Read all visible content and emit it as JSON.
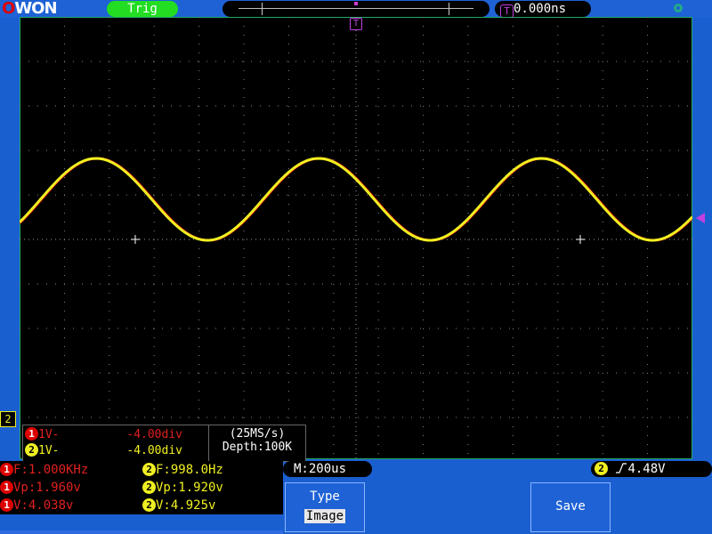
{
  "top": {
    "logo": "OWON",
    "trig_status": "Trig",
    "trig_delay": "0.000ns",
    "trig_icon": "T"
  },
  "channels": {
    "ch1": {
      "label": "1V-",
      "offset": "-4.00div"
    },
    "ch2": {
      "label": "1V-",
      "offset": "-4.00div"
    }
  },
  "acq": {
    "sample_rate": "(25MS/s)",
    "depth": "Depth:100K"
  },
  "measurements": {
    "ch1": {
      "freq": "F:1.000KHz",
      "vp": "Vp:1.960v",
      "v": "V:4.038v"
    },
    "ch2": {
      "freq": "F:998.0Hz",
      "vp": "Vp:1.920v",
      "v": "V:4.925v"
    }
  },
  "timebase": "M:200us",
  "trigger_level": "4.48V",
  "buttons": {
    "type_label": "Type",
    "type_value": "Image",
    "save_label": "Save"
  },
  "ch2_marker": "2",
  "colors": {
    "ch1": "#e01010",
    "ch2": "#f0f020",
    "trigger": "#c040e0",
    "frame": "#1a5fd0"
  },
  "icons": {
    "usb": "usb-icon",
    "trigger_marker": "trigger-position-icon",
    "trigger_level": "trigger-level-arrow-icon"
  }
}
